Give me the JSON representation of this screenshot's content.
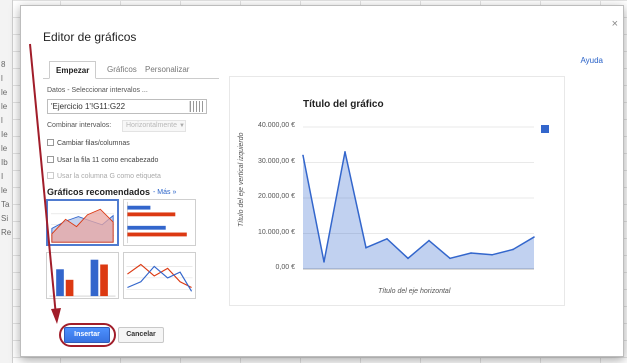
{
  "dialog": {
    "title": "Editor de gráficos",
    "close_glyph": "×",
    "help_label": "Ayuda"
  },
  "tabs": [
    {
      "label": "Empezar",
      "active": true
    },
    {
      "label": "Gráficos",
      "active": false
    },
    {
      "label": "Personalizar",
      "active": false
    }
  ],
  "data_section": {
    "label": "Datos - Seleccionar intervalos ...",
    "range_value": "'Ejercicio 1'!G11:G22",
    "combine_label": "Combinar intervalos:",
    "combine_value": "Horizontalmente"
  },
  "options": [
    {
      "label": "Cambiar filas/columnas",
      "enabled": true
    },
    {
      "label": "Usar la fila 11 como encabezado",
      "enabled": true
    },
    {
      "label": "Usar la columna G como etiqueta",
      "enabled": false
    }
  ],
  "recommended": {
    "title": "Gráficos recomendados",
    "more_label": "- Más »",
    "thumbnails": [
      {
        "kind": "area-chart-icon",
        "selected": true
      },
      {
        "kind": "bar-chart-icon",
        "selected": false
      },
      {
        "kind": "column-chart-icon",
        "selected": false
      },
      {
        "kind": "line-chart-icon",
        "selected": false
      }
    ]
  },
  "chart_data": {
    "type": "area",
    "title": "Título del gráfico",
    "xlabel": "Título del eje horizontal",
    "ylabel": "Título del eje vertical izquierdo",
    "ylim": [
      0,
      40000
    ],
    "yticks": [
      "40.000,00 €",
      "30.000,00 €",
      "20.000,00 €",
      "10.000,00 €",
      "0,00 €"
    ],
    "grid": true,
    "legend": "top-right",
    "series": [
      {
        "color": "#3366cc",
        "values": [
          32000,
          2000,
          33000,
          6000,
          8500,
          3000,
          8000,
          3000,
          4500,
          4000,
          5500,
          9000
        ]
      }
    ]
  },
  "buttons": {
    "insert_label": "Insertar",
    "cancel_label": "Cancelar"
  },
  "annotation_color": "#a11d2a",
  "sheet_gutter_marks": [
    "8",
    "l",
    "le",
    "le",
    "l",
    "Ie",
    "le",
    "Ib",
    "I",
    "le",
    "Ta",
    "Si",
    "Re"
  ]
}
